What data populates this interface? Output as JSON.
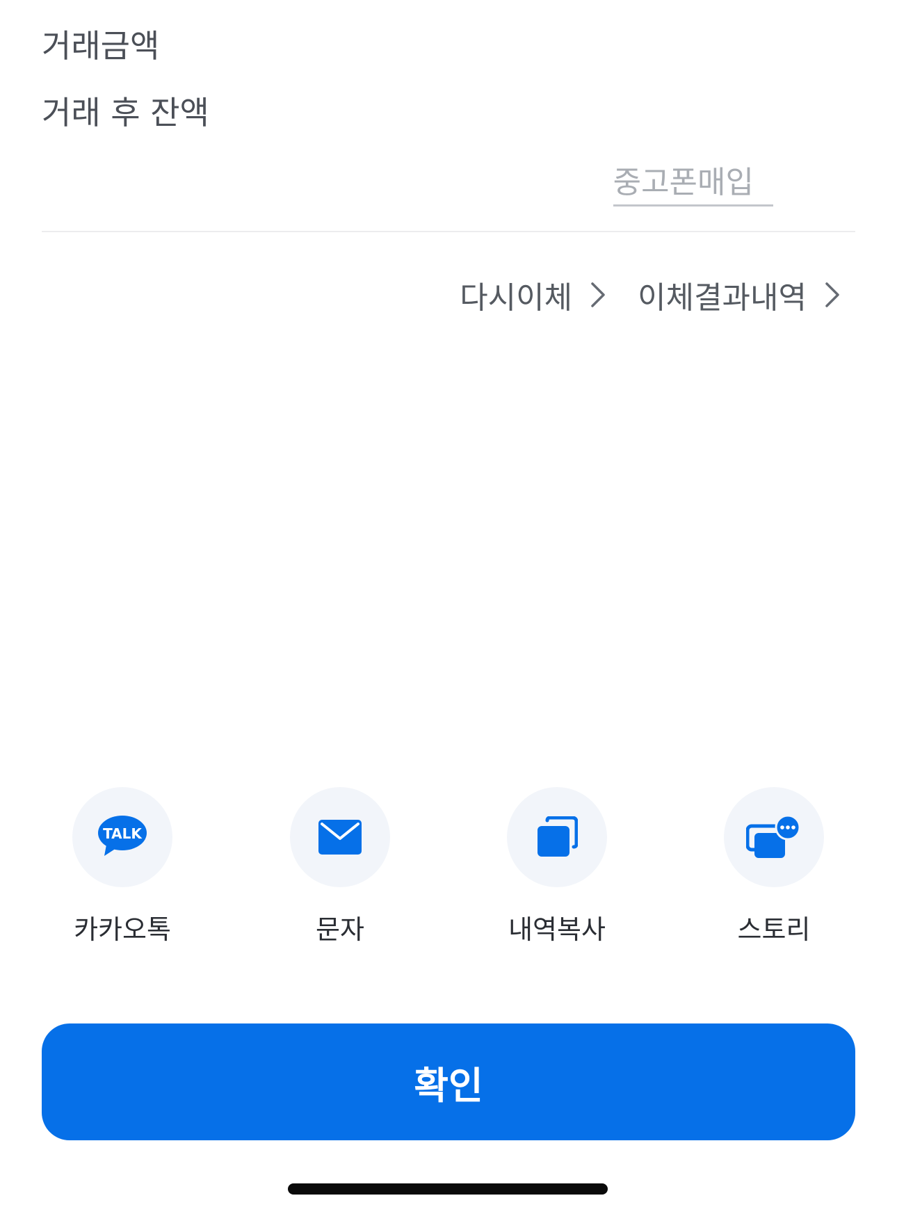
{
  "details": {
    "amount_label": "거래금액",
    "balance_after_label": "거래 후 잔액"
  },
  "promo": {
    "used_phone_label": "중고폰매입"
  },
  "links": {
    "retransfer_label": "다시이체",
    "transfer_result_label": "이체결과내역"
  },
  "share": {
    "items": [
      {
        "label": "카카오톡",
        "icon": "kakaotalk-icon",
        "icon_text": "TALK"
      },
      {
        "label": "문자",
        "icon": "message-envelope-icon"
      },
      {
        "label": "내역복사",
        "icon": "copy-icon"
      },
      {
        "label": "스토리",
        "icon": "story-chat-icon"
      }
    ]
  },
  "confirm": {
    "label": "확인"
  },
  "colors": {
    "primary": "#0670E8",
    "icon_bg": "#F2F5FA",
    "label_text": "#4B4F57",
    "muted_text": "#A9ADB3"
  }
}
